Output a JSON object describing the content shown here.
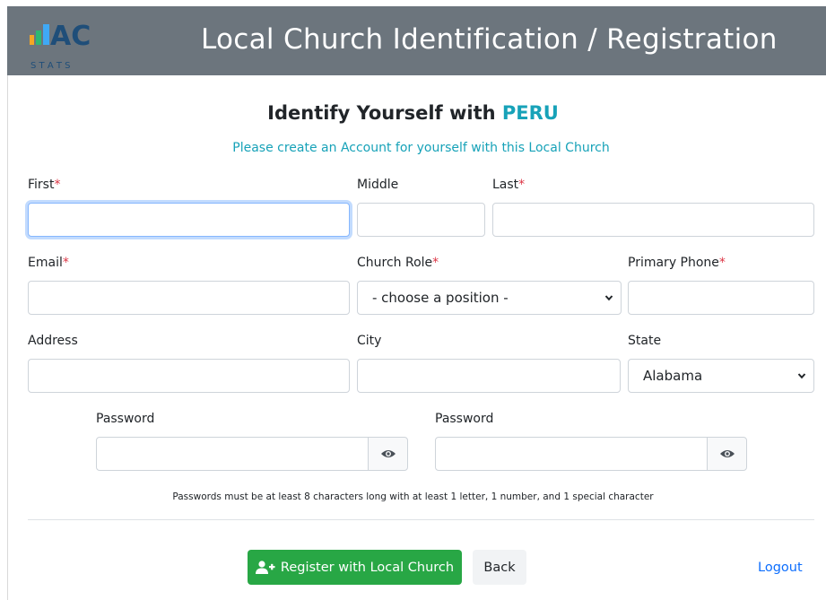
{
  "header": {
    "logo_text": "AC",
    "logo_subtext": "S T A T S",
    "title": "Local Church Identification / Registration",
    "bg_color": "#6c757d"
  },
  "form": {
    "heading_prefix": "Identify Yourself with ",
    "church_name": "PERU",
    "subtitle": "Please create an Account for yourself with this Local Church",
    "required_marker": "*",
    "fields": {
      "first": {
        "label": "First",
        "value": ""
      },
      "middle": {
        "label": "Middle",
        "value": ""
      },
      "last": {
        "label": "Last",
        "value": ""
      },
      "email": {
        "label": "Email",
        "value": ""
      },
      "church_role": {
        "label": "Church Role",
        "selected": "- choose a position -"
      },
      "primary_phone": {
        "label": "Primary Phone",
        "value": ""
      },
      "address": {
        "label": "Address",
        "value": ""
      },
      "city": {
        "label": "City",
        "value": ""
      },
      "state": {
        "label": "State",
        "selected": "Alabama"
      },
      "password": {
        "label": "Password",
        "value": ""
      },
      "password_confirm": {
        "label": "Password",
        "value": ""
      }
    },
    "password_hint": "Passwords must be at least 8 characters long with at least 1 letter, 1 number, and 1 special character"
  },
  "actions": {
    "register_label": "Register with Local Church",
    "back_label": "Back",
    "logout_label": "Logout"
  },
  "icons": {
    "toggle_password": "eye-icon",
    "register": "user-plus-icon",
    "select_arrow": "chevron-down-icon"
  },
  "colors": {
    "accent": "#17a2b8",
    "required": "#dc3545",
    "register_button": "#28a745",
    "link": "#0d6efd"
  }
}
